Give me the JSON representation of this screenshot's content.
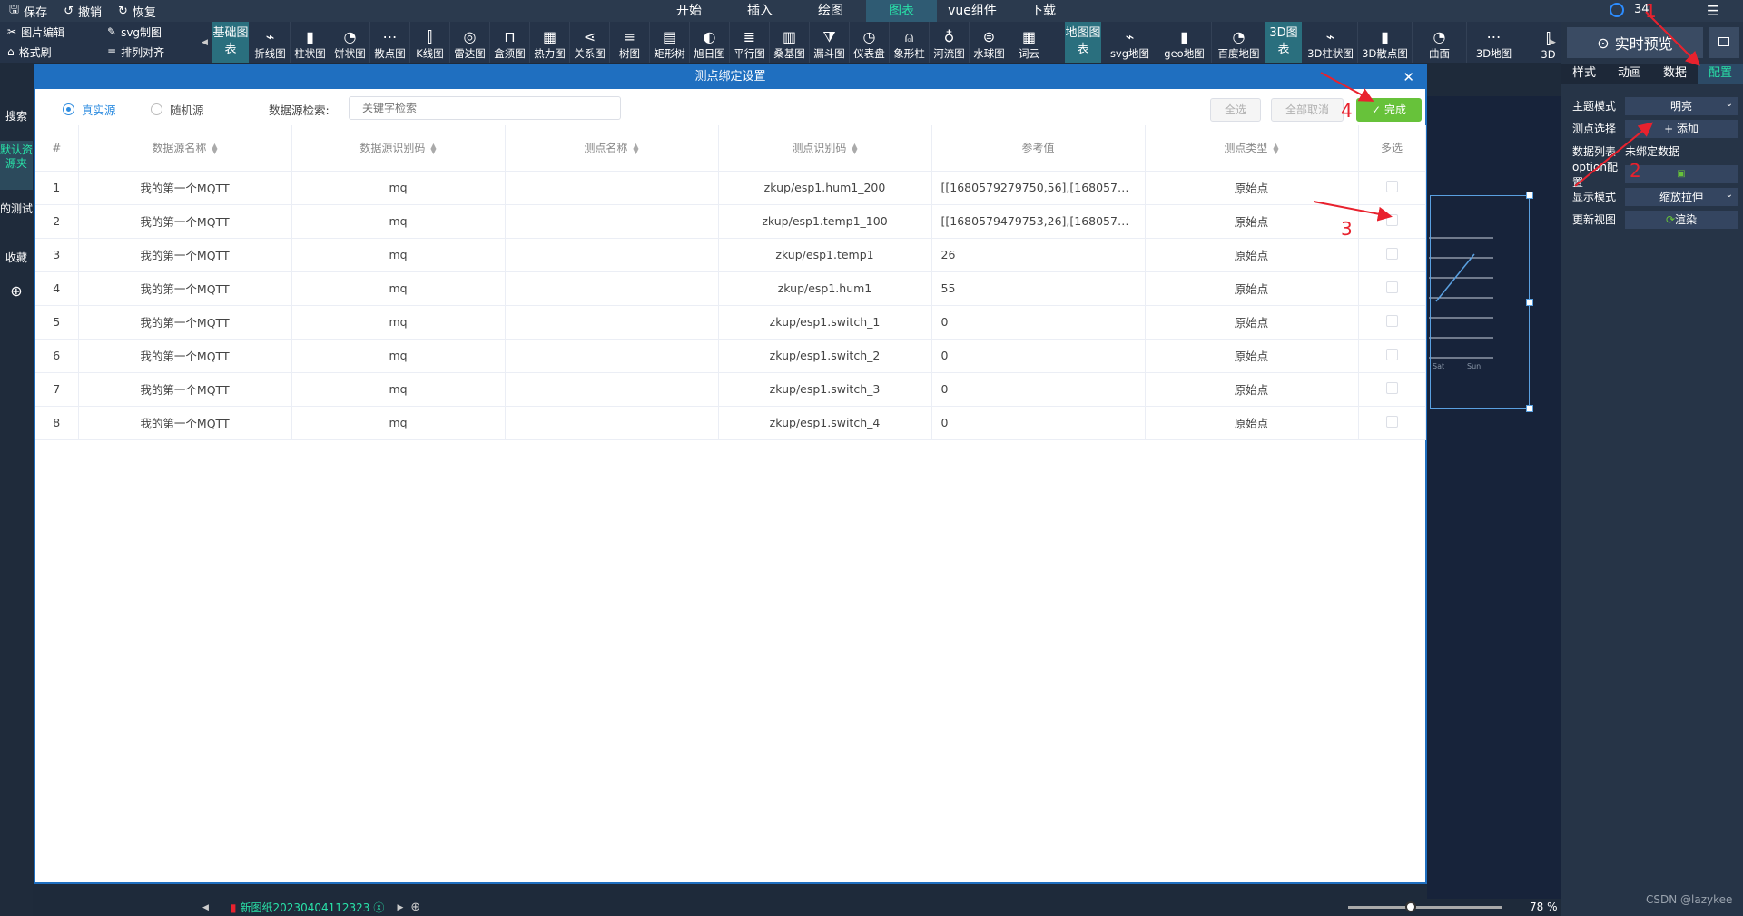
{
  "topbar": {
    "left_items": [
      {
        "icon": "save-icon",
        "label": "保存"
      },
      {
        "icon": "undo-icon",
        "label": "撤销"
      },
      {
        "icon": "redo-icon",
        "label": "恢复"
      }
    ],
    "menu": [
      "开始",
      "插入",
      "绘图",
      "图表",
      "vue组件",
      "下载"
    ],
    "active_menu": "图表",
    "count": "34"
  },
  "toolbar": {
    "left": [
      {
        "icon": "scissors-icon",
        "label": "图片编辑"
      },
      {
        "icon": "pen-icon",
        "label": "svg制图"
      },
      {
        "icon": "brush-icon",
        "label": "格式刷"
      },
      {
        "icon": "align-icon",
        "label": "排列对齐"
      }
    ],
    "basic_category": "基础图表",
    "basic_tools": [
      "折线图",
      "柱状图",
      "饼状图",
      "散点图",
      "K线图",
      "雷达图",
      "盒须图",
      "热力图",
      "关系图",
      "树图",
      "矩形树",
      "旭日图",
      "平行图",
      "桑基图",
      "漏斗图",
      "仪表盘",
      "象形柱",
      "河流图",
      "水球图",
      "词云"
    ],
    "map_category": "地图图表",
    "map_tools": [
      "svg地图",
      "geo地图",
      "百度地图"
    ],
    "threed_category": "3D图表",
    "threed_tools": [
      "3D柱状图",
      "3D散点图",
      "曲面",
      "3D地图",
      "3D"
    ]
  },
  "right_panel": {
    "preview_label": "实时预览",
    "tabs": [
      "样式",
      "动画",
      "数据",
      "配置"
    ],
    "active_tab": "配置",
    "rows": [
      {
        "label": "主题模式",
        "value": "明亮",
        "dropdown": true
      },
      {
        "label": "测点选择",
        "value": "+ 添加",
        "dropdown": false
      },
      {
        "label": "数据列表",
        "value": "未绑定数据",
        "plain": true
      },
      {
        "label": "option配置",
        "value": "",
        "dropdown": false
      },
      {
        "label": "显示模式",
        "value": "缩放拉伸",
        "dropdown": true
      },
      {
        "label": "更新视图",
        "value": "渲染",
        "dropdown": false
      }
    ]
  },
  "left_panel": {
    "items": [
      "搜索",
      "默认资源夹",
      "的测试",
      "收藏"
    ]
  },
  "chart_preview": {
    "ticks": [
      "Sat",
      "Sun"
    ]
  },
  "bottom": {
    "tab_label": "新图纸20230404112323",
    "zoom": "78 %",
    "watermark": "CSDN @lazykee"
  },
  "modal": {
    "title": "测点绑定设置",
    "radio_real": "真实源",
    "radio_random": "随机源",
    "search_label": "数据源检索:",
    "search_placeholder": "关键字检索",
    "btn_select_all": "全选",
    "btn_cancel_all": "全部取消",
    "btn_done": "完成",
    "columns": [
      "#",
      "数据源名称",
      "数据源识别码",
      "测点名称",
      "测点识别码",
      "参考值",
      "测点类型",
      "多选"
    ],
    "rows": [
      {
        "n": "1",
        "source": "我的第一个MQTT",
        "code": "mq",
        "name": "",
        "point": "zkup/esp1.hum1_200",
        "ref": "[[1680579279750,56],[1680579281...",
        "type": "原始点"
      },
      {
        "n": "2",
        "source": "我的第一个MQTT",
        "code": "mq",
        "name": "",
        "point": "zkup/esp1.temp1_100",
        "ref": "[[1680579479753,26],[1680579481...",
        "type": "原始点"
      },
      {
        "n": "3",
        "source": "我的第一个MQTT",
        "code": "mq",
        "name": "",
        "point": "zkup/esp1.temp1",
        "ref": "26",
        "type": "原始点"
      },
      {
        "n": "4",
        "source": "我的第一个MQTT",
        "code": "mq",
        "name": "",
        "point": "zkup/esp1.hum1",
        "ref": "55",
        "type": "原始点"
      },
      {
        "n": "5",
        "source": "我的第一个MQTT",
        "code": "mq",
        "name": "",
        "point": "zkup/esp1.switch_1",
        "ref": "0",
        "type": "原始点"
      },
      {
        "n": "6",
        "source": "我的第一个MQTT",
        "code": "mq",
        "name": "",
        "point": "zkup/esp1.switch_2",
        "ref": "0",
        "type": "原始点"
      },
      {
        "n": "7",
        "source": "我的第一个MQTT",
        "code": "mq",
        "name": "",
        "point": "zkup/esp1.switch_3",
        "ref": "0",
        "type": "原始点"
      },
      {
        "n": "8",
        "source": "我的第一个MQTT",
        "code": "mq",
        "name": "",
        "point": "zkup/esp1.switch_4",
        "ref": "0",
        "type": "原始点"
      }
    ]
  },
  "annotations": [
    "1",
    "2",
    "3",
    "4"
  ],
  "colors": {
    "accent": "#29e1a8",
    "modal_header": "#1f6fc0",
    "done": "#67c23a",
    "annotation": "#e8222e"
  }
}
